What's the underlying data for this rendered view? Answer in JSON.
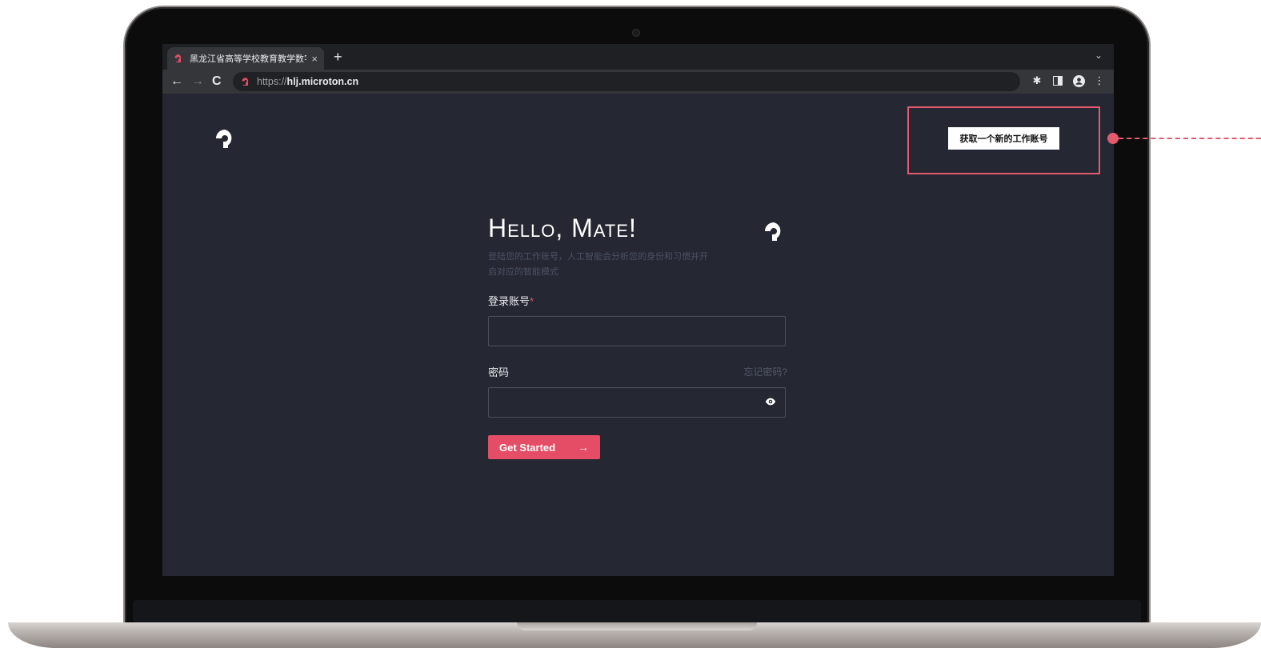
{
  "browser": {
    "tab_title": "黑龙江省高等学校教育教学数字",
    "tab_close": "×",
    "new_tab": "+",
    "url_scheme": "https://",
    "url_host": "hlj.microton.cn"
  },
  "header": {
    "signup_label": "获取一个新的工作账号"
  },
  "login": {
    "title": "Hello, Mate!",
    "subtitle": "登陆您的工作账号，人工智能会分析您的身份和习惯并开启对应的智能模式",
    "account_label": "登录账号",
    "required_mark": "*",
    "account_value": "",
    "password_label": "密码",
    "forgot_label": "忘记密码?",
    "password_value": "",
    "submit_label": "Get Started",
    "submit_arrow": "→"
  },
  "colors": {
    "accent": "#e54c66",
    "page_bg": "#252833",
    "annotation": "#e45a6e"
  }
}
